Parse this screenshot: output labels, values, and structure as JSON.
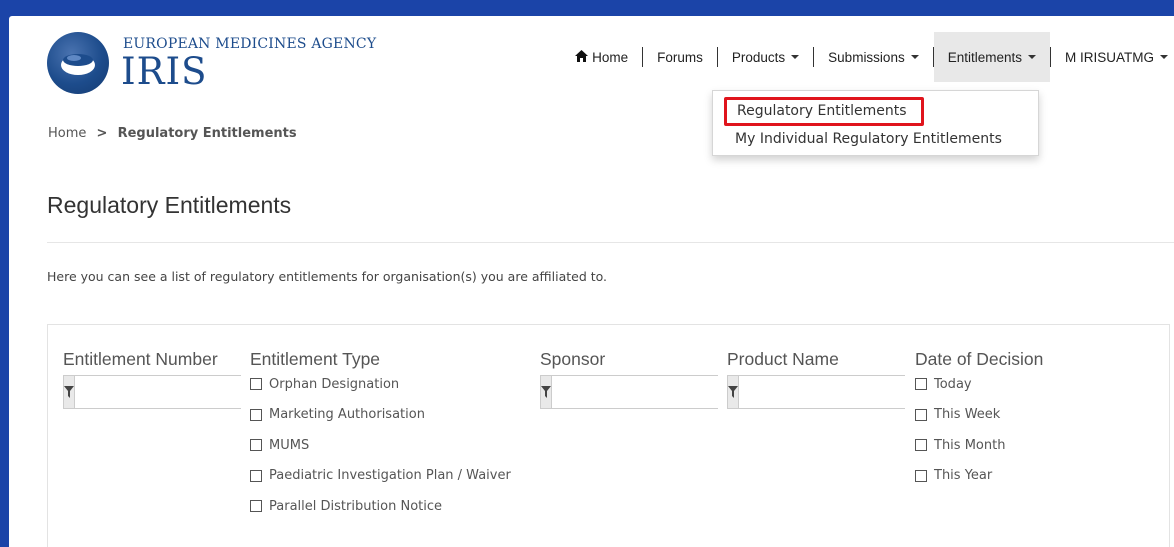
{
  "header": {
    "agency_name": "EUROPEAN MEDICINES AGENCY",
    "app_name": "IRIS"
  },
  "nav": {
    "home": "Home",
    "forums": "Forums",
    "products": "Products",
    "submissions": "Submissions",
    "entitlements": "Entitlements",
    "user": "M IRISUATMG"
  },
  "dropdown": {
    "items": [
      {
        "label": "Regulatory Entitlements"
      },
      {
        "label": "My Individual Regulatory Entitlements"
      }
    ]
  },
  "breadcrumb": {
    "home": "Home",
    "separator": ">",
    "current": "Regulatory Entitlements"
  },
  "page": {
    "title": "Regulatory Entitlements",
    "intro": "Here you can see a list of regulatory entitlements for organisation(s) you are affiliated to."
  },
  "filters": {
    "entitlement_number": {
      "label": "Entitlement Number",
      "value": ""
    },
    "entitlement_type": {
      "label": "Entitlement Type",
      "options": [
        "Orphan Designation",
        "Marketing Authorisation",
        "MUMS",
        "Paediatric Investigation Plan / Waiver",
        "Parallel Distribution Notice"
      ]
    },
    "sponsor": {
      "label": "Sponsor",
      "value": ""
    },
    "product_name": {
      "label": "Product Name",
      "value": ""
    },
    "date_of_decision": {
      "label": "Date of Decision",
      "options": [
        "Today",
        "This Week",
        "This Month",
        "This Year"
      ]
    }
  },
  "colors": {
    "brand": "#1d4c8c",
    "frame": "#1b44a8",
    "highlight": "#e0141c"
  }
}
